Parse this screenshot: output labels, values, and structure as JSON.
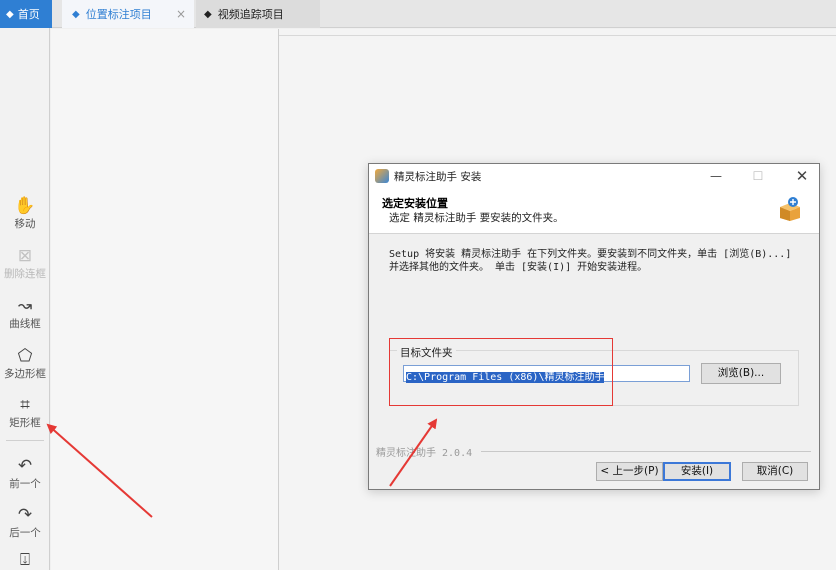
{
  "tabs": {
    "home": {
      "icon": "diamond-icon",
      "label": "首页"
    },
    "position": {
      "icon": "diamond-icon",
      "label": "位置标注项目",
      "close": "×"
    },
    "video": {
      "icon": "diamond-icon",
      "label": "视频追踪项目"
    }
  },
  "toolbar": {
    "move": {
      "icon": "hand-icon",
      "label": "移动"
    },
    "delete_line": {
      "icon": "delete-frame-icon",
      "label": "删除连框",
      "disabled": true
    },
    "curve": {
      "icon": "curve-icon",
      "label": "曲线框"
    },
    "polygon": {
      "icon": "polygon-icon",
      "label": "多边形框"
    },
    "rect": {
      "icon": "rectangle-icon",
      "label": "矩形框"
    },
    "prev": {
      "icon": "arrow-back-icon",
      "label": "前一个"
    },
    "next": {
      "icon": "arrow-forward-icon",
      "label": "后一个"
    },
    "save": {
      "icon": "download-icon"
    }
  },
  "dialog": {
    "title": "精灵标注助手 安装",
    "controls": {
      "min": "—",
      "max": "☐",
      "close": "✕"
    },
    "header_title": "选定安装位置",
    "header_sub": "选定 精灵标注助手 要安装的文件夹。",
    "body_text": "Setup 将安装 精灵标注助手 在下列文件夹。要安装到不同文件夹，单击 [浏览(B)...] 并选择其他的文件夹。 单击 [安装(I)] 开始安装进程。",
    "group_label": "目标文件夹",
    "path_value": "C:\\Program Files (x86)\\精灵标注助手",
    "browse_label": "浏览(B)...",
    "footer_label": "精灵标注助手 2.0.4",
    "back_label": "< 上一步(P)",
    "install_label": "安装(I)",
    "cancel_label": "取消(C)"
  },
  "colors": {
    "accent": "#2f7fd3",
    "annotation": "#e53935",
    "selection": "#2a64c5"
  }
}
